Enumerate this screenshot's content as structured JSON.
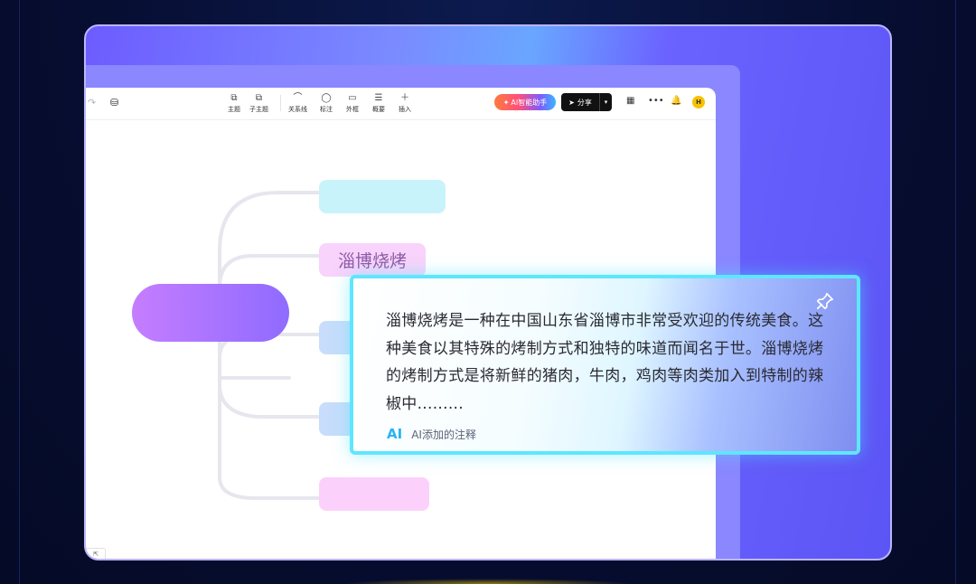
{
  "toolbar": {
    "items": [
      {
        "icon": "topic-icon",
        "label": "主题"
      },
      {
        "icon": "subtopic-icon",
        "label": "子主题"
      },
      {
        "icon": "relation-icon",
        "label": "关系线"
      },
      {
        "icon": "annotation-icon",
        "label": "标注"
      },
      {
        "icon": "frame-icon",
        "label": "外框"
      },
      {
        "icon": "summary-icon",
        "label": "概要"
      },
      {
        "icon": "plus-icon",
        "label": "插入"
      }
    ],
    "ai_assistant_label": "AI智能助手",
    "share_label": "分享",
    "avatar_initial": "H"
  },
  "mindmap": {
    "root_label": "",
    "branches": [
      {
        "label": "",
        "color": "#c9f3fb"
      },
      {
        "label": "淄博烧烤",
        "color": "#f8d3fb"
      },
      {
        "label": "",
        "color": "#c7ddfb"
      },
      {
        "label": "",
        "color": "#c7ddfb"
      },
      {
        "label": "",
        "color": "#fbd1fb"
      }
    ]
  },
  "note": {
    "text": "淄博烧烤是一种在中国山东省淄博市非常受欢迎的传统美食。这种美食以其特殊的烤制方式和独特的味道而闻名于世。淄博烧烤的烤制方式是将新鲜的猪肉，牛肉，鸡肉等肉类加入到特制的辣椒中.........",
    "ai_mark": "AI",
    "footer_label": "AI添加的注释",
    "pin_icon": "pin-icon"
  },
  "colors": {
    "accent_cyan": "#5fe6ff",
    "accent_purple": "#6d5cff",
    "root_gradient_start": "#c57dff",
    "root_gradient_end": "#8f6bff"
  }
}
